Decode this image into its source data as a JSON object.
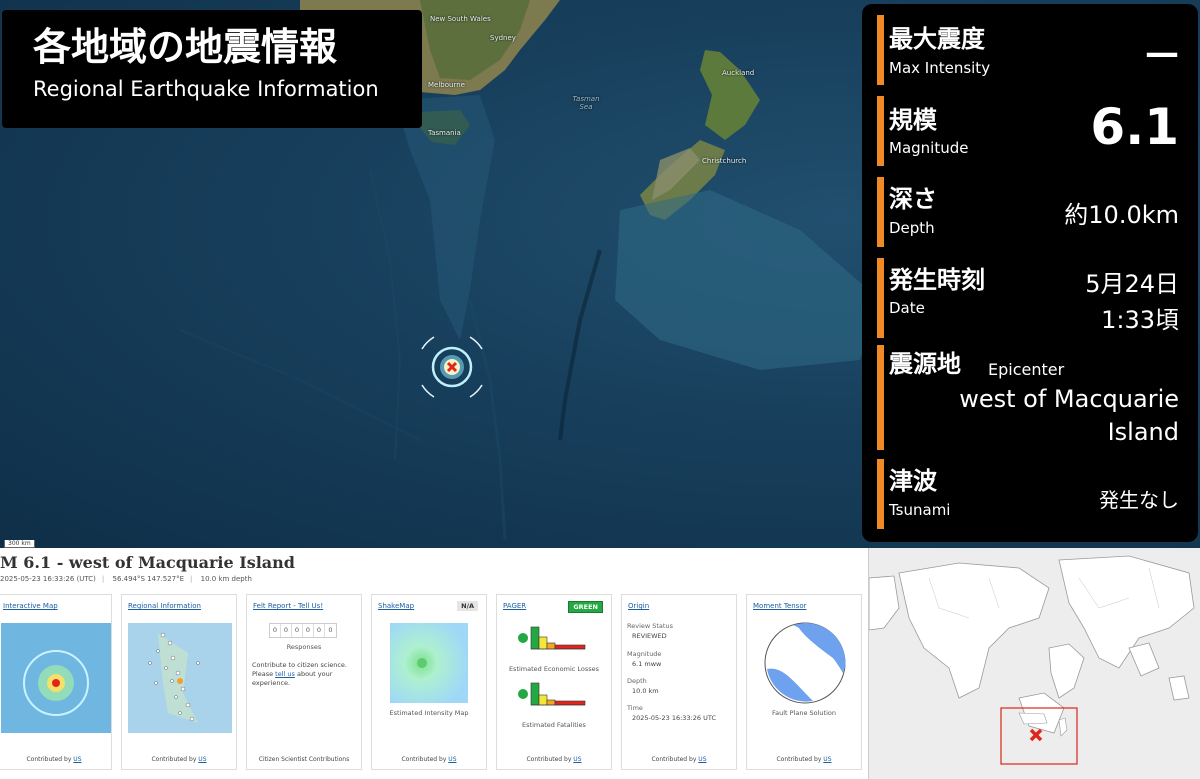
{
  "header": {
    "title_ja": "各地域の地震情報",
    "title_en": "Regional Earthquake Information"
  },
  "info_panel": {
    "accent_color": "#f08a24",
    "rows": [
      {
        "label_ja": "最大震度",
        "label_en": "Max  Intensity",
        "value": "—"
      },
      {
        "label_ja": "規模",
        "label_en": "Magnitude",
        "value": "6.1"
      },
      {
        "label_ja": "深さ",
        "label_en": "Depth",
        "value": "約10.0km"
      },
      {
        "label_ja": "発生時刻",
        "label_en": "Date",
        "value_line1": "5月24日",
        "value_line2": "1:33頃"
      },
      {
        "label_ja": "震源地",
        "label_en": "Epicenter",
        "value_line1": "west of Macquarie",
        "value_line2": "Island"
      },
      {
        "label_ja": "津波",
        "label_en": "Tsunami",
        "value": "発生なし"
      }
    ]
  },
  "map": {
    "labels": {
      "nsw": "New South Wales",
      "sydney": "Sydney",
      "melbourne": "Melbourne",
      "tasmania": "Tasmania",
      "tasman_sea": "Tasman Sea",
      "auckland": "Auckland",
      "christchurch": "Christchurch"
    },
    "scale": "300 km",
    "epicenter_icon": "epicenter-marker-icon"
  },
  "usgs": {
    "title": "M 6.1 - west of Macquarie Island",
    "time": "2025-05-23 16:33:26 (UTC)",
    "coords": "56.494°S 147.527°E",
    "depth": "10.0 km depth",
    "cards": {
      "interactive_map": {
        "title": "Interactive Map",
        "contributed": "Contributed by",
        "network": "US"
      },
      "regional": {
        "title": "Regional Information",
        "contributed": "Contributed by",
        "network": "US"
      },
      "felt": {
        "title": "Felt Report - Tell Us!",
        "digits": [
          "0",
          "0",
          "0",
          "0",
          "0",
          "0"
        ],
        "responses": "Responses",
        "text1": "Contribute to citizen science.",
        "text2_pre": "Please ",
        "text2_link": "tell us",
        "text2_post": " about your",
        "text3": "experience.",
        "foot": "Citizen Scientist Contributions"
      },
      "shakemap": {
        "title": "ShakeMap",
        "tag": "N/A",
        "caption": "Estimated Intensity Map",
        "contributed": "Contributed by",
        "network": "US"
      },
      "pager": {
        "title": "PAGER",
        "tag": "GREEN",
        "caption1": "Estimated Economic Losses",
        "caption2": "Estimated Fatalities",
        "contributed": "Contributed by",
        "network": "US"
      },
      "origin": {
        "title": "Origin",
        "review_label": "Review Status",
        "review_value": "REVIEWED",
        "mag_label": "Magnitude",
        "mag_value": "6.1 mww",
        "depth_label": "Depth",
        "depth_value": "10.0 km",
        "time_label": "Time",
        "time_value": "2025-05-23 16:33:26 UTC",
        "contributed": "Contributed by",
        "network": "US"
      },
      "moment": {
        "title": "Moment Tensor",
        "caption": "Fault Plane Solution",
        "contributed": "Contributed by",
        "network": "US"
      }
    }
  },
  "world_map": {
    "marker_icon": "red-x-icon",
    "highlight_color": "#d9261c"
  }
}
